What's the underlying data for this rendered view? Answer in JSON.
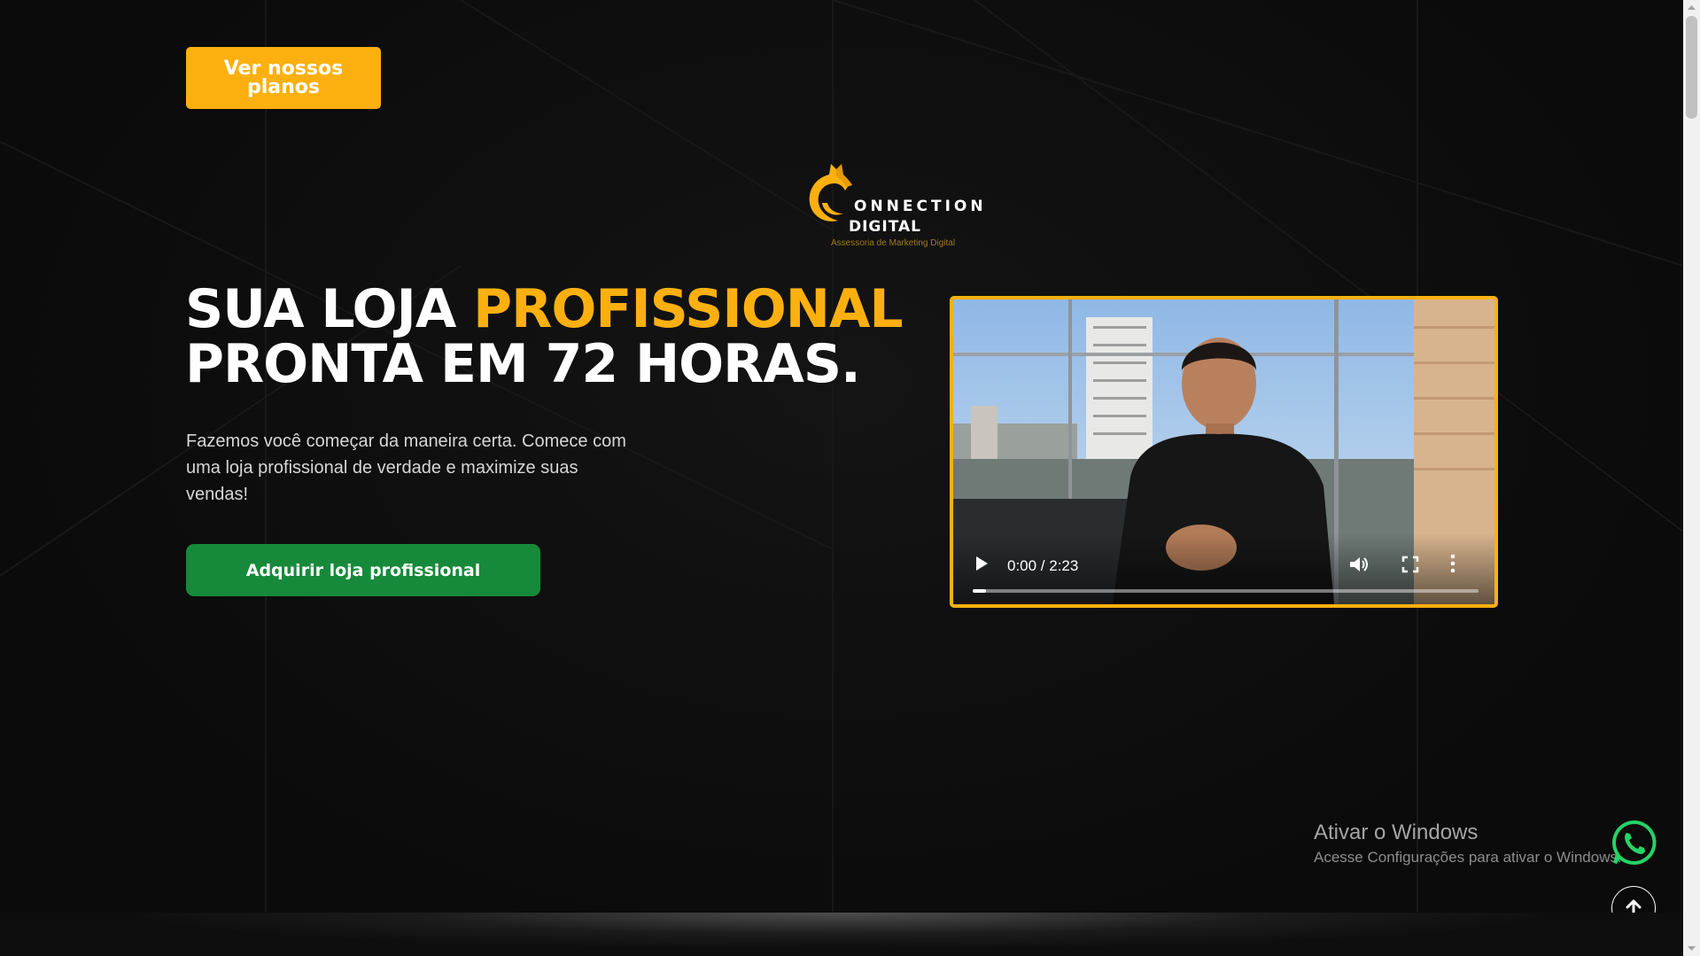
{
  "header": {
    "plans_button": "Ver nossos planos"
  },
  "logo": {
    "word1": "ONNECTION",
    "word2": "DIGITAL",
    "tagline": "Assessoria de Marketing Digital"
  },
  "hero": {
    "headline_part1": "SUA LOJA ",
    "headline_accent": "PROFISSIONAL",
    "headline_line2": "PRONTA EM 72 HORAS.",
    "subtext": "Fazemos você começar da maneira certa. Comece com uma loja profissional de verdade e maximize suas vendas!",
    "cta_button": "Adquirir loja profissional"
  },
  "video": {
    "time": "0:00 / 2:23",
    "progress_fraction": 0.0
  },
  "windows_watermark": {
    "title": "Ativar o Windows",
    "subtitle": "Acesse Configurações para ativar o Windows."
  },
  "icons": {
    "whatsapp": "whatsapp-icon",
    "scroll_top": "arrow-up-icon"
  },
  "colors": {
    "accent": "#fbb00f",
    "cta": "#168a3a",
    "background": "#0c0c0c",
    "whatsapp": "#25d366"
  }
}
